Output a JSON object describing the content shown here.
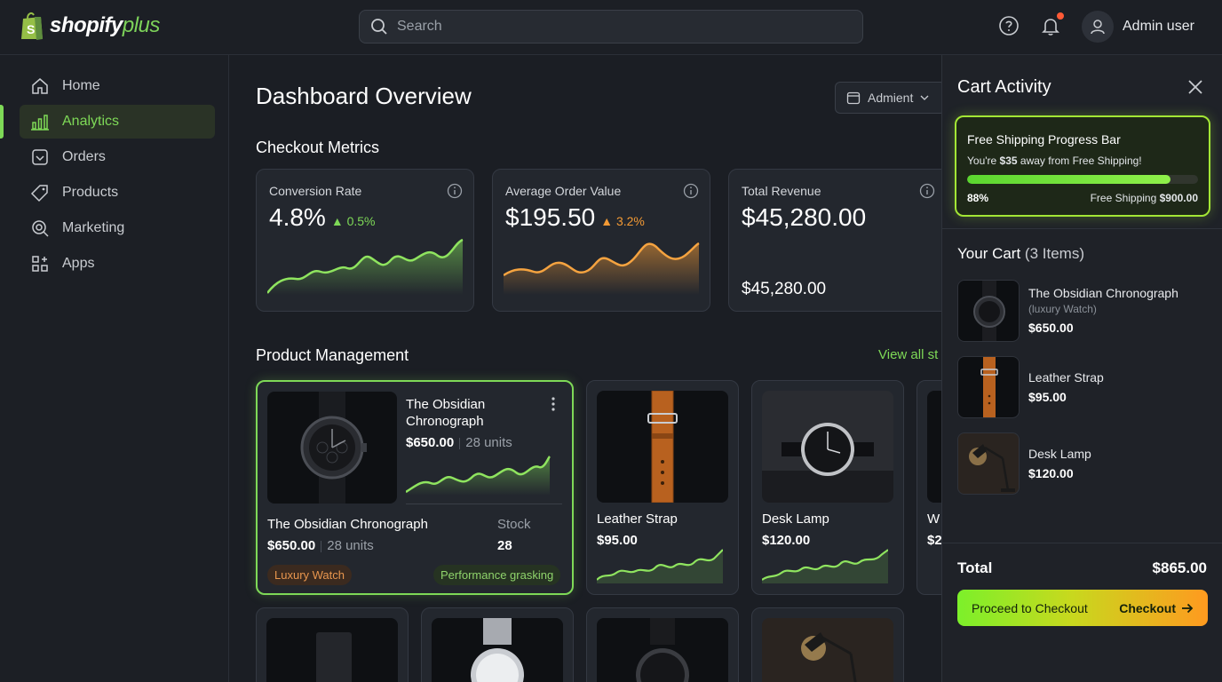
{
  "brand": {
    "name": "shopify",
    "suffix": "plus"
  },
  "search": {
    "placeholder": "Search"
  },
  "header": {
    "user_name": "Admin user"
  },
  "sidebar": {
    "items": [
      {
        "label": "Home",
        "icon": "home-icon"
      },
      {
        "label": "Analytics",
        "icon": "analytics-icon",
        "active": true
      },
      {
        "label": "Orders",
        "icon": "orders-icon"
      },
      {
        "label": "Products",
        "icon": "tag-icon"
      },
      {
        "label": "Marketing",
        "icon": "marketing-icon"
      },
      {
        "label": "Apps",
        "icon": "apps-icon"
      }
    ]
  },
  "main": {
    "title": "Dashboard Overview",
    "date_filter": "Admient",
    "checkout_section": "Checkout Metrics",
    "metrics": [
      {
        "label": "Conversion Rate",
        "value": "4.8%",
        "delta": "▲ 0.5%",
        "color": "#7ed957"
      },
      {
        "label": "Average Order Value",
        "value": "$195.50",
        "delta": "▲ 3.2%",
        "color": "#f39a35"
      },
      {
        "label": "Total Revenue",
        "value": "$45,280.00",
        "sub": "$45,280.00"
      }
    ],
    "products_section": "Product Management",
    "view_all": "View all st",
    "featured": {
      "title": "The Obsidian Chronograph",
      "price": "$650.00",
      "units": "28 units",
      "name": "The Obsidian Chronograph",
      "price2": "$650.00",
      "units2": "28 units",
      "stock_label": "Stock",
      "stock_value": "28",
      "tag1": "Luxury Watch",
      "tag2": "Performance grasking"
    },
    "products": [
      {
        "name": "Leather Strap",
        "price": "$95.00"
      },
      {
        "name": "Desk Lamp",
        "price": "$120.00"
      },
      {
        "name": "W",
        "price": "$2"
      }
    ]
  },
  "cart": {
    "title": "Cart Activity",
    "shipping": {
      "title": "Free Shipping Progress Bar",
      "message_prefix": "You're ",
      "message_amount": "$35",
      "message_suffix": " away from Free Shipping!",
      "progress_pct": 88,
      "progress_label": "88%",
      "right_prefix": "Free Shipping ",
      "right_amount": "$900.00"
    },
    "heading": "Your Cart",
    "count": "(3 Items)",
    "items": [
      {
        "name": "The Obsidian Chronograph",
        "note": "(luxury Watch)",
        "price": "$650.00"
      },
      {
        "name": "Leather Strap",
        "price": "$95.00"
      },
      {
        "name": "Desk Lamp",
        "price": "$120.00"
      }
    ],
    "total_label": "Total",
    "total_value": "$865.00",
    "checkout_left": "Proceed to Checkout",
    "checkout_right": "Checkout"
  }
}
